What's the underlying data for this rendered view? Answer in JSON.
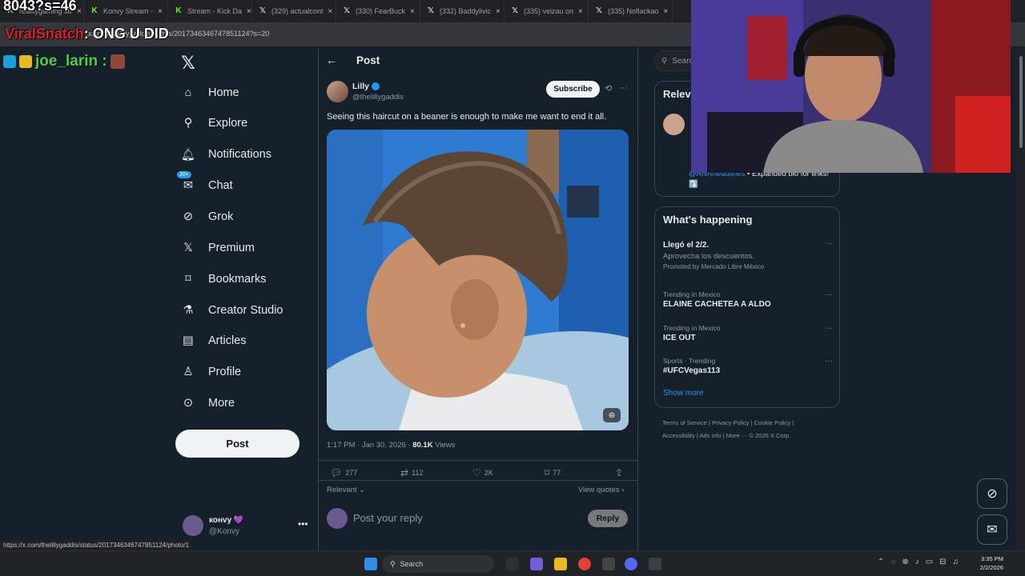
{
  "browser": {
    "tabs": [
      {
        "label": "realitygaming str",
        "icon": "kick-icon"
      },
      {
        "label": "Konvy Stream -",
        "icon": "kick-icon"
      },
      {
        "label": "Stream - Kick Da",
        "icon": "kick-icon"
      },
      {
        "label": "(329) actualcont",
        "icon": "x-icon"
      },
      {
        "label": "(330) FearBuck",
        "icon": "x-icon"
      },
      {
        "label": "(332) Baddylivic",
        "icon": "x-icon"
      },
      {
        "label": "(335) veizau on",
        "icon": "x-icon"
      },
      {
        "label": "(335) Noflackao",
        "icon": "x-icon"
      }
    ],
    "url": "x.com/thelillygaddis/status/2017346346747851124?s=20",
    "status_url": "https://x.com/thelillygaddis/status/2017346346747851124/photo/1"
  },
  "overlay": {
    "top_text": "8043?s=46",
    "chat_user": "ViralSnatch",
    "chat_message": ": ONG U DID",
    "follower": "joe_larin :"
  },
  "nav": {
    "items": [
      {
        "label": "Home",
        "icon": "home-icon"
      },
      {
        "label": "Explore",
        "icon": "search-icon"
      },
      {
        "label": "Notifications",
        "icon": "bell-icon"
      },
      {
        "label": "Chat",
        "icon": "mail-icon",
        "badge": "20+"
      },
      {
        "label": "Grok",
        "icon": "grok-icon"
      },
      {
        "label": "Premium",
        "icon": "x-icon"
      },
      {
        "label": "Bookmarks",
        "icon": "bookmark-icon"
      },
      {
        "label": "Creator Studio",
        "icon": "flask-icon"
      },
      {
        "label": "Articles",
        "icon": "article-icon"
      },
      {
        "label": "Profile",
        "icon": "person-icon"
      },
      {
        "label": "More",
        "icon": "more-circle-icon"
      }
    ],
    "post_label": "Post"
  },
  "account": {
    "name": "конvy 💜",
    "handle": "@Konvy"
  },
  "post": {
    "header": "Post",
    "author_name": "Lilly",
    "author_handle": "@thelillygaddis",
    "subscribe_label": "Subscribe",
    "text": "Seeing this haircut on a beaner is enough to make me want to end it all.",
    "time": "1:17 PM · Jan 30, 2026 · ",
    "views_count": "80.1K",
    "views_label": " Views",
    "replies": "277",
    "reposts": "112",
    "likes": "2K",
    "bookmarks": "77",
    "sort_label": "Relevant",
    "view_quotes": "View quotes",
    "reply_placeholder": "Post your reply",
    "reply_button": "Reply"
  },
  "sidebar": {
    "search_placeholder": "Search",
    "relevant_title": "Relevant people",
    "relevant_bio_link": "@ANRheadlines",
    "relevant_bio_text": " • Expanded bio for links!⤵️",
    "whats_happening": "What's happening",
    "trends": [
      {
        "context": "",
        "name": "Llegó el 2/2.",
        "sub": "Aprovecha los descuentos.",
        "promo": "Promoted by Mercado Libre México"
      },
      {
        "context": "Trending in Mexico",
        "name": "ELAINE CACHETEA A ALDO",
        "sub": "",
        "promo": ""
      },
      {
        "context": "Trending in Mexico",
        "name": "ICE OUT",
        "sub": "",
        "promo": ""
      },
      {
        "context": "Sports · Trending",
        "name": "#UFCVegas113",
        "sub": "",
        "promo": ""
      }
    ],
    "show_more": "Show more",
    "footer_line1": "Terms of Service  |  Privacy Policy  |  Cookie Policy  |",
    "footer_line2": "Accessibility  |  Ads info  |  More ···  © 2026 X Corp."
  },
  "taskbar": {
    "search_label": "Search",
    "time": "3:35 PM",
    "date": "2/2/2026"
  },
  "colors": {
    "background": "#15202b",
    "accent": "#1d9bf0",
    "border": "#38444d"
  }
}
